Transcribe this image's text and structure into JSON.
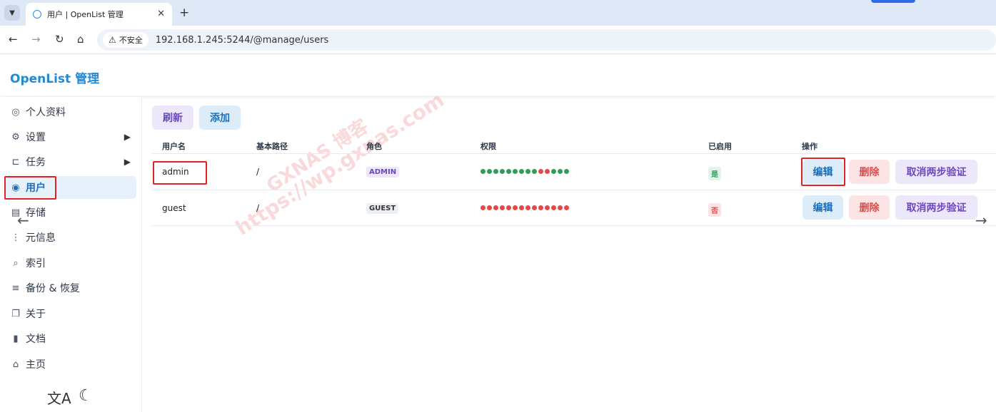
{
  "browser": {
    "tab_title": "用户 | OpenList 管理",
    "tab_close": "✕",
    "new_tab": "+",
    "security_label": "不安全",
    "url": "192.168.1.245:5244/@manage/users"
  },
  "app": {
    "brand": "OpenList 管理"
  },
  "sidebar": {
    "items": [
      {
        "label": "个人资料",
        "icon": "fingerprint-icon"
      },
      {
        "label": "设置",
        "icon": "gear-icon"
      },
      {
        "label": "任务",
        "icon": "tasks-icon"
      },
      {
        "label": "用户",
        "icon": "user-circle-icon"
      },
      {
        "label": "存储",
        "icon": "storage-icon"
      },
      {
        "label": "元信息",
        "icon": "meta-icon"
      },
      {
        "label": "索引",
        "icon": "search-icon"
      },
      {
        "label": "备份 & 恢复",
        "icon": "database-icon"
      },
      {
        "label": "关于",
        "icon": "copy-icon"
      },
      {
        "label": "文档",
        "icon": "book-icon"
      },
      {
        "label": "主页",
        "icon": "home-icon"
      }
    ],
    "active_index": 3
  },
  "toolbar": {
    "refresh": "刷新",
    "add": "添加"
  },
  "table": {
    "headers": [
      "用户名",
      "基本路径",
      "角色",
      "权限",
      "已启用",
      "操作"
    ],
    "rows": [
      {
        "username": "admin",
        "base_path": "/",
        "role": "ADMIN",
        "permission_colors": [
          "#2f9e5c",
          "#2f9e5c",
          "#2f9e5c",
          "#2f9e5c",
          "#2f9e5c",
          "#2f9e5c",
          "#2f9e5c",
          "#2f9e5c",
          "#2f9e5c",
          "#e04a4a",
          "#e04a4a",
          "#2f9e5c",
          "#2f9e5c",
          "#2f9e5c"
        ],
        "enabled": "是",
        "actions": {
          "edit": "编辑",
          "delete": "删除",
          "cancel_2fa": "取消两步验证"
        }
      },
      {
        "username": "guest",
        "base_path": "/",
        "role": "GUEST",
        "permission_colors": [
          "#e04a4a",
          "#e04a4a",
          "#e04a4a",
          "#e04a4a",
          "#e04a4a",
          "#e04a4a",
          "#e04a4a",
          "#e04a4a",
          "#e04a4a",
          "#e04a4a",
          "#e04a4a",
          "#e04a4a",
          "#e04a4a",
          "#e04a4a"
        ],
        "enabled": "否",
        "actions": {
          "edit": "编辑",
          "delete": "删除",
          "cancel_2fa": "取消两步验证"
        }
      }
    ]
  },
  "watermark": {
    "line1": "GXNAS 博客",
    "line2": "https://wp.gxnas.com"
  }
}
